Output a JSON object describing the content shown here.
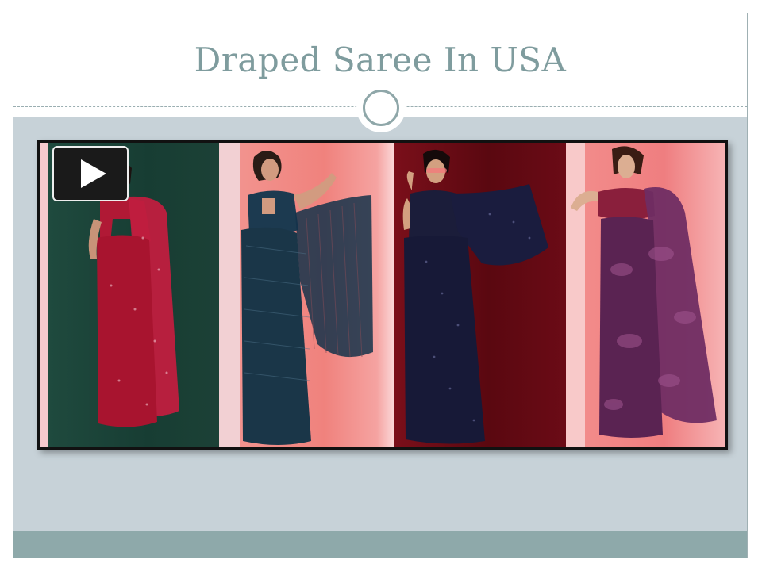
{
  "slide": {
    "title": "Draped Saree In USA"
  },
  "media": {
    "play_icon": "play-icon",
    "panels": [
      {
        "name": "red-sequin-saree",
        "saree_color": "#b8183a",
        "background": "#1d4438"
      },
      {
        "name": "teal-striped-saree",
        "saree_color": "#1f3f52",
        "background": "#f28a86"
      },
      {
        "name": "navy-sequin-saree",
        "saree_color": "#1a1d3d",
        "background": "#640a14"
      },
      {
        "name": "purple-tie-dye-saree",
        "saree_color": "#6a2a5e",
        "background": "#f28a8a"
      }
    ]
  },
  "colors": {
    "title": "#7f9c9e",
    "content_background": "#c7d2d8",
    "footer_band": "#8ea9aa"
  }
}
